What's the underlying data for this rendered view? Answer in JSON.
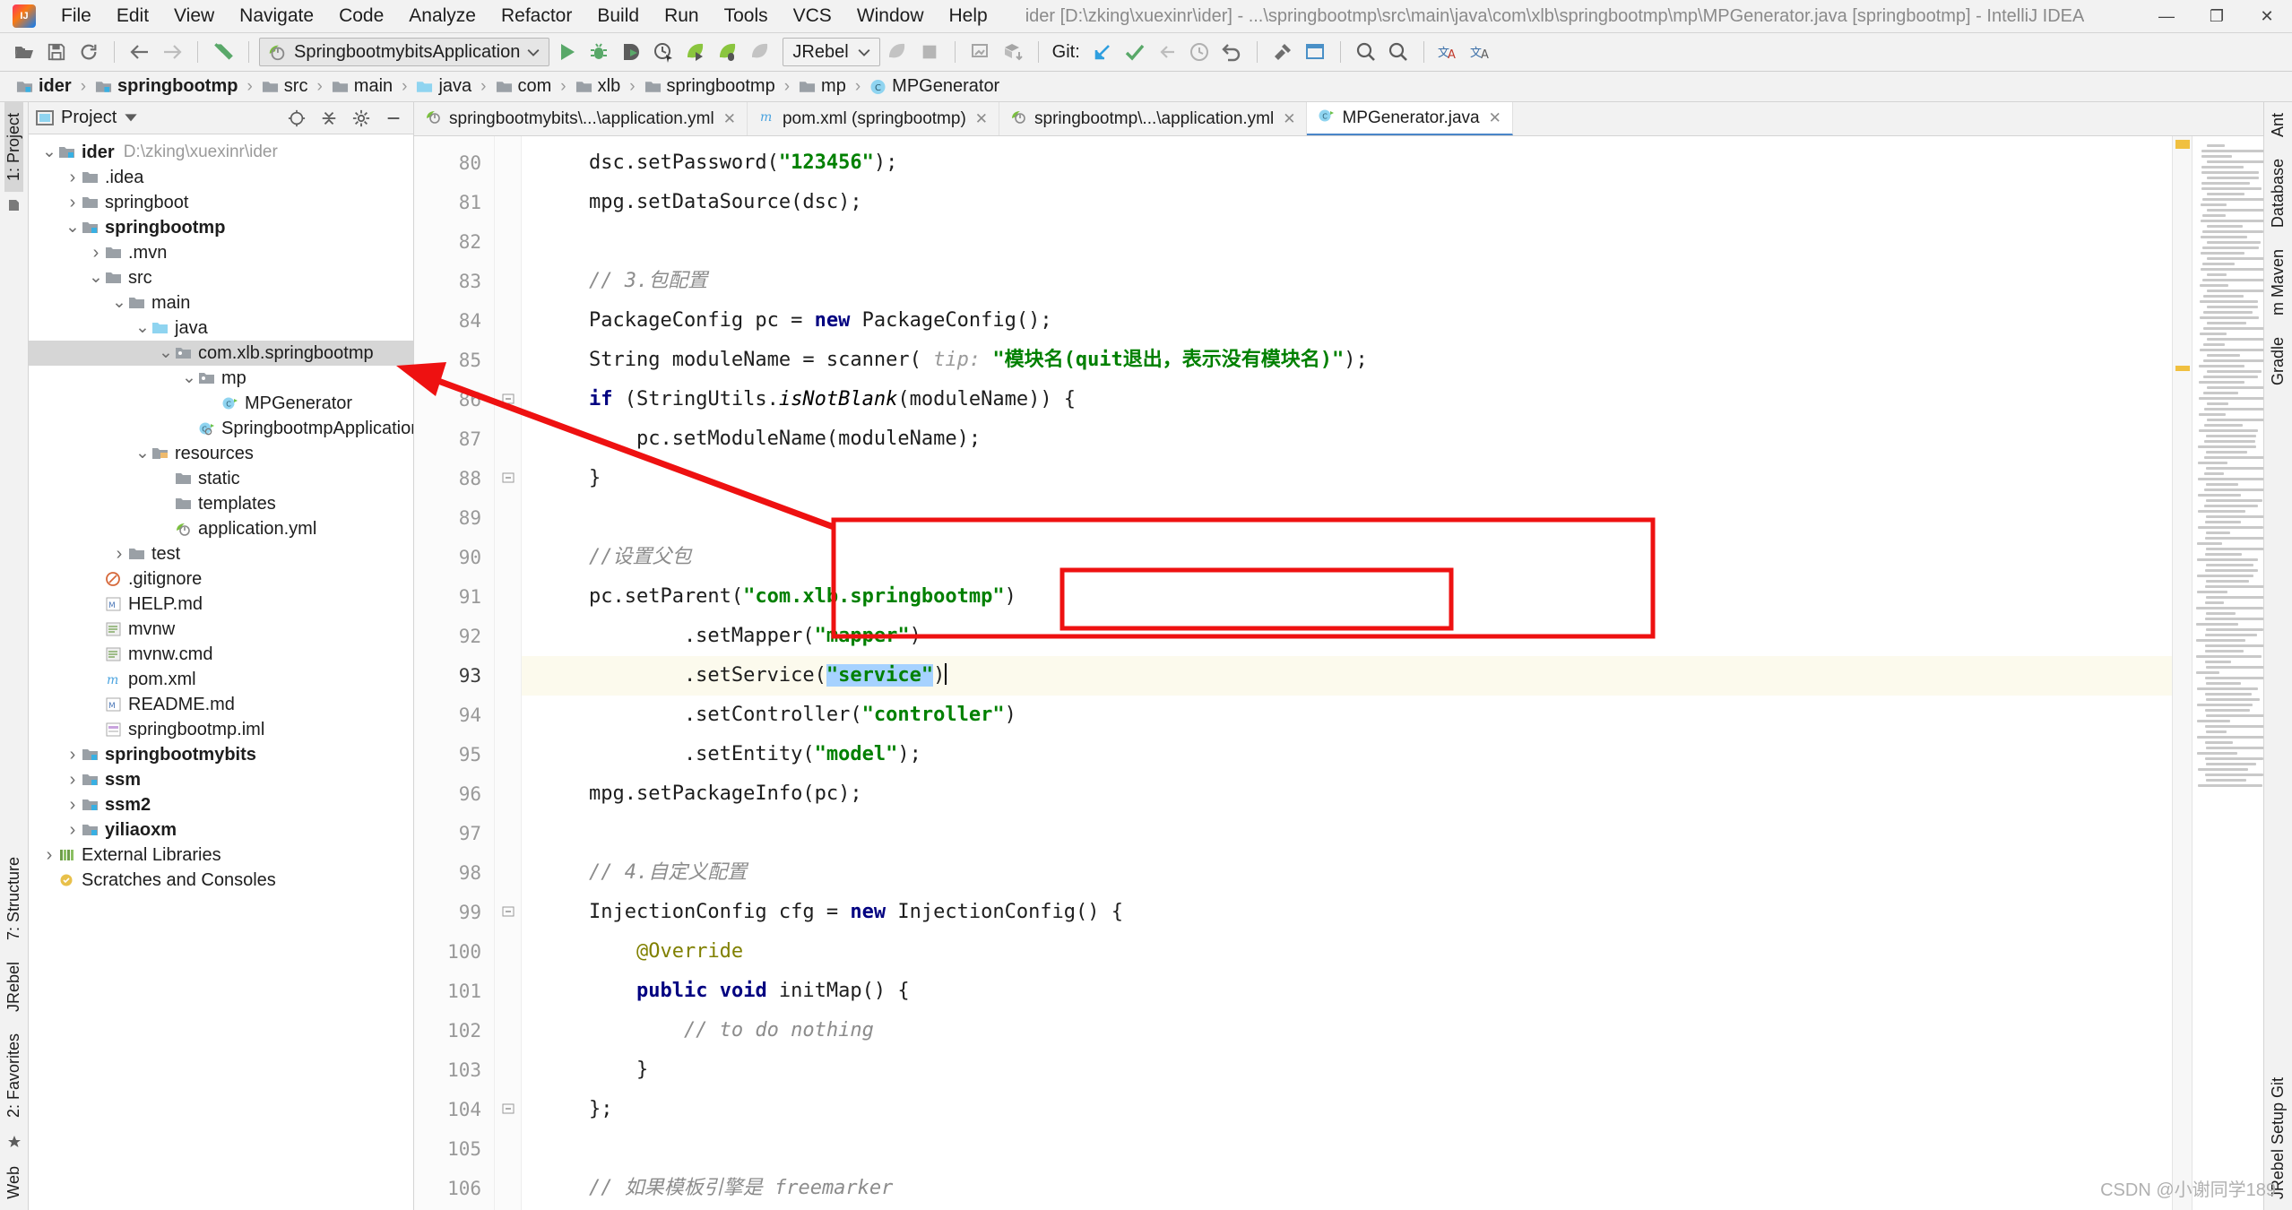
{
  "window": {
    "title": "ider [D:\\zking\\xuexinr\\ider] - ...\\springbootmp\\src\\main\\java\\com\\xlb\\springbootmp\\mp\\MPGenerator.java [springbootmp] - IntelliJ IDEA",
    "minimize": "—",
    "maximize": "❐",
    "close": "✕"
  },
  "menubar": {
    "items": [
      "File",
      "Edit",
      "View",
      "Navigate",
      "Code",
      "Analyze",
      "Refactor",
      "Build",
      "Run",
      "Tools",
      "VCS",
      "Window",
      "Help"
    ]
  },
  "toolbar": {
    "run_config": "SpringbootmybitsApplication",
    "jrebel": "JRebel",
    "git_label": "Git:",
    "icons": [
      "open-folder-icon",
      "save-icon",
      "sync-icon",
      "back-arrow-icon",
      "forward-arrow-icon",
      "undo-arrow-icon",
      "run-icon",
      "debug-icon",
      "run-with-coverage-icon",
      "profile-icon",
      "jrebel-run-icon",
      "jrebel-debug-icon",
      "jrebel-disabled-icon",
      "jrebel-stop-icon",
      "stop-icon",
      "build-icon",
      "maven-reload-icon",
      "git-update-icon",
      "git-commit-icon",
      "git-push-icon",
      "git-history-icon",
      "git-revert-icon",
      "search-everywhere-icon",
      "settings-icon",
      "magnifier-icon",
      "translate-icon",
      "translate-alt-icon"
    ]
  },
  "breadcrumb": {
    "items": [
      {
        "label": "ider",
        "icon": "module-folder-icon",
        "bold": true
      },
      {
        "label": "springbootmp",
        "icon": "module-folder-icon",
        "bold": true
      },
      {
        "label": "src",
        "icon": "folder-icon",
        "bold": false
      },
      {
        "label": "main",
        "icon": "folder-icon",
        "bold": false
      },
      {
        "label": "java",
        "icon": "source-folder-icon",
        "bold": false
      },
      {
        "label": "com",
        "icon": "folder-icon",
        "bold": false
      },
      {
        "label": "xlb",
        "icon": "folder-icon",
        "bold": false
      },
      {
        "label": "springbootmp",
        "icon": "folder-icon",
        "bold": false
      },
      {
        "label": "mp",
        "icon": "folder-icon",
        "bold": false
      },
      {
        "label": "MPGenerator",
        "icon": "java-class-icon",
        "bold": false
      }
    ],
    "separator": "›"
  },
  "left_strip": {
    "tabs": [
      "1: Project",
      "7: Structure",
      "JRebel",
      "2: Favorites",
      "Web"
    ],
    "bookmark_icon": "bookmark-icon"
  },
  "right_strip": {
    "tabs": [
      "Ant",
      "Database",
      "m Maven",
      "Gradle",
      "JRebel Setup Git"
    ]
  },
  "project_panel": {
    "title": "Project",
    "toolbar_icons": [
      "locate-icon",
      "collapse-all-icon",
      "settings-icon",
      "hide-icon"
    ],
    "tree": [
      {
        "depth": 0,
        "arrow": "down",
        "icon": "module-folder-icon",
        "label": "ider",
        "bold": true,
        "path": "D:\\zking\\xuexinr\\ider",
        "selected": false
      },
      {
        "depth": 1,
        "arrow": "right",
        "icon": "folder-icon",
        "label": ".idea",
        "bold": false,
        "path": "",
        "selected": false
      },
      {
        "depth": 1,
        "arrow": "right",
        "icon": "folder-icon",
        "label": "springboot",
        "bold": false,
        "path": "",
        "selected": false
      },
      {
        "depth": 1,
        "arrow": "down",
        "icon": "module-folder-icon",
        "label": "springbootmp",
        "bold": true,
        "path": "",
        "selected": false
      },
      {
        "depth": 2,
        "arrow": "right",
        "icon": "folder-icon",
        "label": ".mvn",
        "bold": false,
        "path": "",
        "selected": false
      },
      {
        "depth": 2,
        "arrow": "down",
        "icon": "folder-icon",
        "label": "src",
        "bold": false,
        "path": "",
        "selected": false
      },
      {
        "depth": 3,
        "arrow": "down",
        "icon": "folder-icon",
        "label": "main",
        "bold": false,
        "path": "",
        "selected": false
      },
      {
        "depth": 4,
        "arrow": "down",
        "icon": "source-folder-icon",
        "label": "java",
        "bold": false,
        "path": "",
        "selected": false
      },
      {
        "depth": 5,
        "arrow": "down",
        "icon": "package-icon",
        "label": "com.xlb.springbootmp",
        "bold": false,
        "path": "",
        "selected": true
      },
      {
        "depth": 6,
        "arrow": "down",
        "icon": "package-icon",
        "label": "mp",
        "bold": false,
        "path": "",
        "selected": false
      },
      {
        "depth": 7,
        "arrow": "none",
        "icon": "java-class-icon",
        "label": "MPGenerator",
        "bold": false,
        "path": "",
        "selected": false
      },
      {
        "depth": 6,
        "arrow": "none",
        "icon": "spring-class-icon",
        "label": "SpringbootmpApplication",
        "bold": false,
        "path": "",
        "selected": false
      },
      {
        "depth": 4,
        "arrow": "down",
        "icon": "resources-folder-icon",
        "label": "resources",
        "bold": false,
        "path": "",
        "selected": false
      },
      {
        "depth": 5,
        "arrow": "none",
        "icon": "folder-icon",
        "label": "static",
        "bold": false,
        "path": "",
        "selected": false
      },
      {
        "depth": 5,
        "arrow": "none",
        "icon": "folder-icon",
        "label": "templates",
        "bold": false,
        "path": "",
        "selected": false
      },
      {
        "depth": 5,
        "arrow": "none",
        "icon": "yml-icon",
        "label": "application.yml",
        "bold": false,
        "path": "",
        "selected": false
      },
      {
        "depth": 3,
        "arrow": "right",
        "icon": "folder-icon",
        "label": "test",
        "bold": false,
        "path": "",
        "selected": false
      },
      {
        "depth": 2,
        "arrow": "none",
        "icon": "gitignore-icon",
        "label": ".gitignore",
        "bold": false,
        "path": "",
        "selected": false
      },
      {
        "depth": 2,
        "arrow": "none",
        "icon": "md-icon",
        "label": "HELP.md",
        "bold": false,
        "path": "",
        "selected": false
      },
      {
        "depth": 2,
        "arrow": "none",
        "icon": "script-icon",
        "label": "mvnw",
        "bold": false,
        "path": "",
        "selected": false
      },
      {
        "depth": 2,
        "arrow": "none",
        "icon": "script-icon",
        "label": "mvnw.cmd",
        "bold": false,
        "path": "",
        "selected": false
      },
      {
        "depth": 2,
        "arrow": "none",
        "icon": "maven-icon",
        "label": "pom.xml",
        "bold": false,
        "path": "",
        "selected": false
      },
      {
        "depth": 2,
        "arrow": "none",
        "icon": "md-icon",
        "label": "README.md",
        "bold": false,
        "path": "",
        "selected": false
      },
      {
        "depth": 2,
        "arrow": "none",
        "icon": "iml-icon",
        "label": "springbootmp.iml",
        "bold": false,
        "path": "",
        "selected": false
      },
      {
        "depth": 1,
        "arrow": "right",
        "icon": "module-folder-icon",
        "label": "springbootmybits",
        "bold": true,
        "path": "",
        "selected": false
      },
      {
        "depth": 1,
        "arrow": "right",
        "icon": "module-folder-icon",
        "label": "ssm",
        "bold": true,
        "path": "",
        "selected": false
      },
      {
        "depth": 1,
        "arrow": "right",
        "icon": "module-folder-icon",
        "label": "ssm2",
        "bold": true,
        "path": "",
        "selected": false
      },
      {
        "depth": 1,
        "arrow": "right",
        "icon": "module-folder-icon",
        "label": "yiliaoxm",
        "bold": true,
        "path": "",
        "selected": false
      },
      {
        "depth": 0,
        "arrow": "right",
        "icon": "library-icon",
        "label": "External Libraries",
        "bold": false,
        "path": "",
        "selected": false
      },
      {
        "depth": 0,
        "arrow": "none",
        "icon": "scratch-icon",
        "label": "Scratches and Consoles",
        "bold": false,
        "path": "",
        "selected": false
      }
    ]
  },
  "editor": {
    "tabs": [
      {
        "label": "springbootmybits\\...\\application.yml",
        "icon": "yml-icon",
        "active": false,
        "close": "✕"
      },
      {
        "label": "pom.xml (springbootmp)",
        "icon": "maven-icon",
        "active": false,
        "close": "✕"
      },
      {
        "label": "springbootmp\\...\\application.yml",
        "icon": "yml-icon",
        "active": false,
        "close": "✕"
      },
      {
        "label": "MPGenerator.java",
        "icon": "java-class-icon",
        "active": true,
        "close": "✕"
      }
    ],
    "first_line": 80,
    "current_line": 93,
    "lines": [
      {
        "n": 80,
        "fold": "",
        "hl": false,
        "tokens": [
          {
            "t": "    dsc.setPassword(",
            "c": "pl"
          },
          {
            "t": "\"123456\"",
            "c": "str"
          },
          {
            "t": ");",
            "c": "pl"
          }
        ]
      },
      {
        "n": 81,
        "fold": "",
        "hl": false,
        "tokens": [
          {
            "t": "    mpg.setDataSource(dsc);",
            "c": "pl"
          }
        ]
      },
      {
        "n": 82,
        "fold": "",
        "hl": false,
        "tokens": [
          {
            "t": "",
            "c": "pl"
          }
        ]
      },
      {
        "n": 83,
        "fold": "",
        "hl": false,
        "tokens": [
          {
            "t": "    // 3.包配置",
            "c": "cmt"
          }
        ]
      },
      {
        "n": 84,
        "fold": "",
        "hl": false,
        "tokens": [
          {
            "t": "    PackageConfig pc = ",
            "c": "pl"
          },
          {
            "t": "new",
            "c": "kw"
          },
          {
            "t": " PackageConfig();",
            "c": "pl"
          }
        ]
      },
      {
        "n": 85,
        "fold": "",
        "hl": false,
        "tokens": [
          {
            "t": "    String moduleName = scanner( ",
            "c": "pl"
          },
          {
            "t": "tip:",
            "c": "hint"
          },
          {
            "t": " ",
            "c": "pl"
          },
          {
            "t": "\"模块名(quit退出，表示没有模块名)\"",
            "c": "str"
          },
          {
            "t": ");",
            "c": "pl"
          }
        ]
      },
      {
        "n": 86,
        "fold": "-",
        "hl": false,
        "tokens": [
          {
            "t": "    ",
            "c": "pl"
          },
          {
            "t": "if",
            "c": "kw"
          },
          {
            "t": " (StringUtils.",
            "c": "pl"
          },
          {
            "t": "isNotBlank",
            "c": "ital"
          },
          {
            "t": "(moduleName)) {",
            "c": "pl"
          }
        ]
      },
      {
        "n": 87,
        "fold": "",
        "hl": false,
        "tokens": [
          {
            "t": "        pc.setModuleName(moduleName);",
            "c": "pl"
          }
        ]
      },
      {
        "n": 88,
        "fold": "-",
        "hl": false,
        "tokens": [
          {
            "t": "    }",
            "c": "pl"
          }
        ]
      },
      {
        "n": 89,
        "fold": "",
        "hl": false,
        "tokens": [
          {
            "t": "",
            "c": "pl"
          }
        ]
      },
      {
        "n": 90,
        "fold": "",
        "hl": false,
        "tokens": [
          {
            "t": "    //设置父包",
            "c": "cmt"
          }
        ]
      },
      {
        "n": 91,
        "fold": "",
        "hl": false,
        "tokens": [
          {
            "t": "    pc.setParent(",
            "c": "pl"
          },
          {
            "t": "\"com.xlb.springbootmp\"",
            "c": "str"
          },
          {
            "t": ")",
            "c": "pl"
          }
        ]
      },
      {
        "n": 92,
        "fold": "",
        "hl": false,
        "tokens": [
          {
            "t": "            .setMapper(",
            "c": "pl"
          },
          {
            "t": "\"mapper\"",
            "c": "str"
          },
          {
            "t": ")",
            "c": "pl"
          }
        ]
      },
      {
        "n": 93,
        "fold": "",
        "hl": true,
        "tokens": [
          {
            "t": "            .setService(",
            "c": "pl"
          },
          {
            "t": "\"service\"",
            "c": "strsel"
          },
          {
            "t": ")",
            "c": "pl"
          },
          {
            "t": "|",
            "c": "caret"
          }
        ]
      },
      {
        "n": 94,
        "fold": "",
        "hl": false,
        "tokens": [
          {
            "t": "            .setController(",
            "c": "pl"
          },
          {
            "t": "\"controller\"",
            "c": "str"
          },
          {
            "t": ")",
            "c": "pl"
          }
        ]
      },
      {
        "n": 95,
        "fold": "",
        "hl": false,
        "tokens": [
          {
            "t": "            .setEntity(",
            "c": "pl"
          },
          {
            "t": "\"model\"",
            "c": "str"
          },
          {
            "t": ");",
            "c": "pl"
          }
        ]
      },
      {
        "n": 96,
        "fold": "",
        "hl": false,
        "tokens": [
          {
            "t": "    mpg.setPackageInfo(pc);",
            "c": "pl"
          }
        ]
      },
      {
        "n": 97,
        "fold": "",
        "hl": false,
        "tokens": [
          {
            "t": "",
            "c": "pl"
          }
        ]
      },
      {
        "n": 98,
        "fold": "",
        "hl": false,
        "tokens": [
          {
            "t": "    // 4.自定义配置",
            "c": "cmt"
          }
        ]
      },
      {
        "n": 99,
        "fold": "-",
        "hl": false,
        "tokens": [
          {
            "t": "    InjectionConfig cfg = ",
            "c": "pl"
          },
          {
            "t": "new",
            "c": "kw"
          },
          {
            "t": " InjectionConfig() {",
            "c": "pl"
          }
        ]
      },
      {
        "n": 100,
        "fold": "",
        "hl": false,
        "tokens": [
          {
            "t": "        ",
            "c": "pl"
          },
          {
            "t": "@Override",
            "c": "ann"
          }
        ]
      },
      {
        "n": 101,
        "fold": "",
        "hl": false,
        "gicon": "override-icon",
        "tokens": [
          {
            "t": "        ",
            "c": "pl"
          },
          {
            "t": "public",
            "c": "kw"
          },
          {
            "t": " ",
            "c": "pl"
          },
          {
            "t": "void",
            "c": "kw"
          },
          {
            "t": " initMap() {",
            "c": "pl"
          }
        ]
      },
      {
        "n": 102,
        "fold": "",
        "hl": false,
        "tokens": [
          {
            "t": "            // to do nothing",
            "c": "cmt"
          }
        ]
      },
      {
        "n": 103,
        "fold": "",
        "hl": false,
        "tokens": [
          {
            "t": "        }",
            "c": "pl"
          }
        ]
      },
      {
        "n": 104,
        "fold": "-",
        "hl": false,
        "tokens": [
          {
            "t": "    };",
            "c": "pl"
          }
        ]
      },
      {
        "n": 105,
        "fold": "",
        "hl": false,
        "tokens": [
          {
            "t": "",
            "c": "pl"
          }
        ]
      },
      {
        "n": 106,
        "fold": "",
        "hl": false,
        "tokens": [
          {
            "t": "    // 如果模板引擎是 freemarker",
            "c": "cmt"
          }
        ]
      }
    ]
  },
  "annotations": {
    "outer_box": "highlight-rectangle-outer",
    "inner_box": "highlight-rectangle-inner",
    "arrow": "red-pointer-arrow",
    "color": "#ee1111"
  },
  "watermark": "CSDN @小谢同学189"
}
